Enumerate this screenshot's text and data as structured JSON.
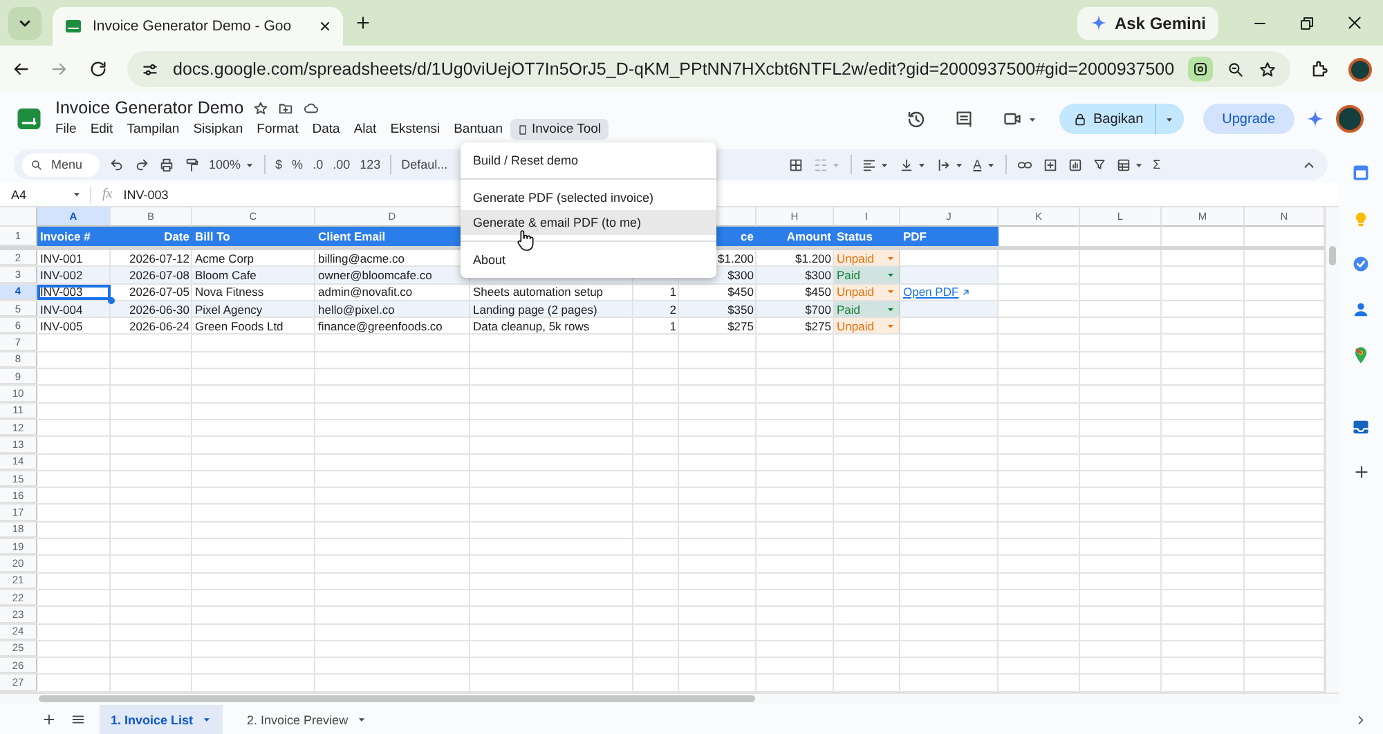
{
  "browser": {
    "tab_title": "Invoice Generator Demo - Goo",
    "gemini_button": "Ask Gemini",
    "url": "docs.google.com/spreadsheets/d/1Ug0viUejOT7In5OrJ5_D-qKM_PPtNN7HXcbt6NTFL2w/edit?gid=2000937500#gid=2000937500"
  },
  "doc": {
    "title": "Invoice Generator Demo",
    "menus": [
      {
        "label": "File",
        "selected": false
      },
      {
        "label": "Edit",
        "selected": false
      },
      {
        "label": "Tampilan",
        "selected": false
      },
      {
        "label": "Sisipkan",
        "selected": false
      },
      {
        "label": "Format",
        "selected": false
      },
      {
        "label": "Data",
        "selected": false
      },
      {
        "label": "Alat",
        "selected": false
      },
      {
        "label": "Ekstensi",
        "selected": false
      },
      {
        "label": "Bantuan",
        "selected": false
      },
      {
        "label": "Invoice Tool",
        "selected": true
      }
    ],
    "share_button": "Bagikan",
    "upgrade_button": "Upgrade"
  },
  "toolbar": {
    "search": "Menu",
    "zoom": "100%",
    "currency": "$",
    "percent": "%",
    "decrease_decimal": ".0",
    "increase_decimal": ".00",
    "number_format": "123",
    "font": "Defaul...",
    "text_color": "A",
    "functions": "Σ"
  },
  "formula_bar": {
    "cell_ref": "A4",
    "function_label": "fx",
    "value": "INV-003"
  },
  "sheet": {
    "columns": {
      "a": {
        "text": "A",
        "selected": true
      },
      "b": {
        "text": "B",
        "selected": false
      },
      "c": {
        "text": "C",
        "selected": false
      },
      "d": {
        "text": "D",
        "selected": false
      },
      "h": {
        "text": "H",
        "selected": false
      },
      "i": {
        "text": "I",
        "selected": false
      },
      "j": {
        "text": "J",
        "selected": false
      },
      "k": {
        "text": "K",
        "selected": false
      },
      "l": {
        "text": "L",
        "selected": false
      },
      "m": {
        "text": "M",
        "selected": false
      },
      "n": {
        "text": "N",
        "selected": false
      }
    },
    "rows": [
      {
        "number": "1",
        "kind": "header",
        "selected": false,
        "cells": {
          "a": "Invoice #",
          "b": "Date",
          "c": "Bill To",
          "d": "Client Email",
          "g": "ce",
          "h": "Amount",
          "i": "Status",
          "j": "PDF"
        }
      },
      {
        "number": "2",
        "kind": "data",
        "selected": false,
        "cells": {
          "a": "INV-001",
          "b": "2026-07-12",
          "c": "Acme Corp",
          "d": "billing@acme.co",
          "g": "$1.200",
          "h": "$1.200",
          "i": {
            "kind": "status",
            "text": "Unpaid",
            "color": "#e8710a"
          }
        }
      },
      {
        "number": "3",
        "kind": "data",
        "selected": false,
        "cells": {
          "a": "INV-002",
          "b": "2026-07-08",
          "c": "Bloom Cafe",
          "d": "owner@bloomcafe.co",
          "g": "$300",
          "h": "$300",
          "i": {
            "kind": "status",
            "text": "Paid",
            "color": "#188038"
          }
        }
      },
      {
        "number": "4",
        "kind": "data",
        "selected": true,
        "cells": {
          "a": "INV-003",
          "b": "2026-07-05",
          "c": "Nova Fitness",
          "d": "admin@novafit.co",
          "e": "Sheets automation setup",
          "f": "1",
          "g": "$450",
          "h": "$450",
          "i": {
            "kind": "status",
            "text": "Unpaid",
            "color": "#e8710a"
          },
          "j": {
            "kind": "link",
            "text": "Open PDF"
          }
        }
      },
      {
        "number": "5",
        "kind": "data",
        "selected": false,
        "cells": {
          "a": "INV-004",
          "b": "2026-06-30",
          "c": "Pixel Agency",
          "d": "hello@pixel.co",
          "e": "Landing page (2 pages)",
          "f": "2",
          "g": "$350",
          "h": "$700",
          "i": {
            "kind": "status",
            "text": "Paid",
            "color": "#188038"
          }
        }
      },
      {
        "number": "6",
        "kind": "data",
        "selected": false,
        "cells": {
          "a": "INV-005",
          "b": "2026-06-24",
          "c": "Green Foods Ltd",
          "d": "finance@greenfoods.co",
          "e": "Data cleanup, 5k rows",
          "f": "1",
          "g": "$275",
          "h": "$275",
          "i": {
            "kind": "status",
            "text": "Unpaid",
            "color": "#e8710a"
          }
        }
      },
      {
        "number": "7",
        "kind": "data",
        "selected": false
      },
      {
        "number": "8",
        "kind": "data",
        "selected": false
      },
      {
        "number": "9",
        "kind": "data",
        "selected": false
      },
      {
        "number": "10",
        "kind": "data",
        "selected": false
      },
      {
        "number": "11",
        "kind": "data",
        "selected": false
      },
      {
        "number": "12",
        "kind": "data",
        "selected": false
      },
      {
        "number": "13",
        "kind": "data",
        "selected": false
      },
      {
        "number": "14",
        "kind": "data",
        "selected": false
      },
      {
        "number": "15",
        "kind": "data",
        "selected": false
      },
      {
        "number": "16",
        "kind": "data",
        "selected": false
      },
      {
        "number": "17",
        "kind": "data",
        "selected": false
      },
      {
        "number": "18",
        "kind": "data",
        "selected": false
      },
      {
        "number": "19",
        "kind": "data",
        "selected": false
      },
      {
        "number": "20",
        "kind": "data",
        "selected": false
      },
      {
        "number": "21",
        "kind": "data",
        "selected": false
      },
      {
        "number": "22",
        "kind": "data",
        "selected": false
      },
      {
        "number": "23",
        "kind": "data",
        "selected": false
      },
      {
        "number": "24",
        "kind": "data",
        "selected": false
      },
      {
        "number": "25",
        "kind": "data",
        "selected": false
      },
      {
        "number": "26",
        "kind": "data",
        "selected": false
      },
      {
        "number": "27",
        "kind": "data",
        "selected": false
      }
    ]
  },
  "dropdown": {
    "groups": [
      {
        "items": [
          {
            "label": "Build / Reset demo",
            "highlighted": false
          }
        ]
      },
      {
        "items": [
          {
            "label": "Generate PDF (selected invoice)",
            "highlighted": false
          },
          {
            "label": "Generate & email PDF (to me)",
            "highlighted": true
          }
        ]
      },
      {
        "items": [
          {
            "label": "About",
            "highlighted": false
          }
        ]
      }
    ]
  },
  "sheet_tabs": [
    {
      "label": "1. Invoice List",
      "selected": true
    },
    {
      "label": "2. Invoice Preview",
      "selected": false
    }
  ]
}
